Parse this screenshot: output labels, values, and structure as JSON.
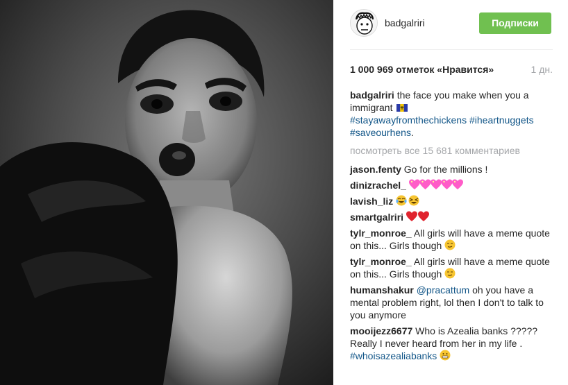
{
  "post": {
    "username": "badgalriri",
    "follow_label": "Подписки",
    "likes": "1 000 969 отметок «Нравится»",
    "age": "1 дн.",
    "caption": {
      "user": "badgalriri",
      "text": "the face you make when you a immigrant",
      "tag1": "#stayawayfromthechickens",
      "tag2": "#iheartnuggets",
      "tag3": "#saveourhens",
      "end": "."
    },
    "view_all": "посмотреть все 15 681 комментариев"
  },
  "comments": [
    {
      "user": "jason.fenty",
      "text": "Go for the millions !"
    },
    {
      "user": "dinizrachel_",
      "text": ""
    },
    {
      "user": "lavish_liz",
      "text": ""
    },
    {
      "user": "smartgalriri",
      "text": ""
    },
    {
      "user": "tylr_monroe_",
      "text": "All girls will have a meme quote on this... Girls though"
    },
    {
      "user": "tylr_monroe_",
      "text": "All girls will have a meme quote on this... Girls though"
    },
    {
      "user": "humanshakur",
      "mention": "@pracattum",
      "text": "oh you have a mental problem right, lol then I don't to talk to you anymore"
    },
    {
      "user": "mooijezz6677",
      "text": "Who is Azealia banks ????? Really I never heard from her in my life .",
      "tag": "#whoisazealiabanks"
    }
  ],
  "icons": {
    "avatar": "cartoon-face-avatar",
    "flag": "barbados-flag-icon",
    "hearts": "sparkling-heart-icon",
    "laugh": "tears-of-joy-emoji",
    "heart_red": "red-heart-icon",
    "smile": "smiling-face-emoji"
  },
  "colors": {
    "follow": "#70c050",
    "tag": "#125688",
    "muted": "#a5a7aa"
  }
}
